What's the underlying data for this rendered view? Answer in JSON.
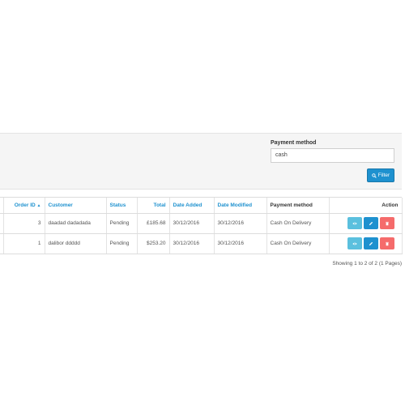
{
  "filter": {
    "payment_method_label": "Payment method",
    "payment_method_value": "cash",
    "filter_button_label": "Filter"
  },
  "table": {
    "headers": {
      "order_id": "Order ID",
      "customer": "Customer",
      "status": "Status",
      "total": "Total",
      "date_added": "Date Added",
      "date_modified": "Date Modified",
      "payment_method": "Payment method",
      "action": "Action"
    },
    "sort_indicator": "▲",
    "rows": [
      {
        "order_id": "3",
        "customer": "daadad dadadada",
        "status": "Pending",
        "total": "£185.68",
        "date_added": "30/12/2016",
        "date_modified": "30/12/2016",
        "payment_method": "Cash On Delivery"
      },
      {
        "order_id": "1",
        "customer": "dalibor ddddd",
        "status": "Pending",
        "total": "$253.20",
        "date_added": "30/12/2016",
        "date_modified": "30/12/2016",
        "payment_method": "Cash On Delivery"
      }
    ]
  },
  "pagination": {
    "summary": "Showing 1 to 2 of 2 (1 Pages)"
  },
  "colors": {
    "link_blue": "#1e91cf",
    "view_button": "#5bc0de",
    "edit_button": "#1e91cf",
    "delete_button": "#f56b6b"
  },
  "icons": {
    "filter": "search-icon",
    "view": "eye-icon",
    "edit": "pencil-icon",
    "delete": "trash-icon"
  }
}
